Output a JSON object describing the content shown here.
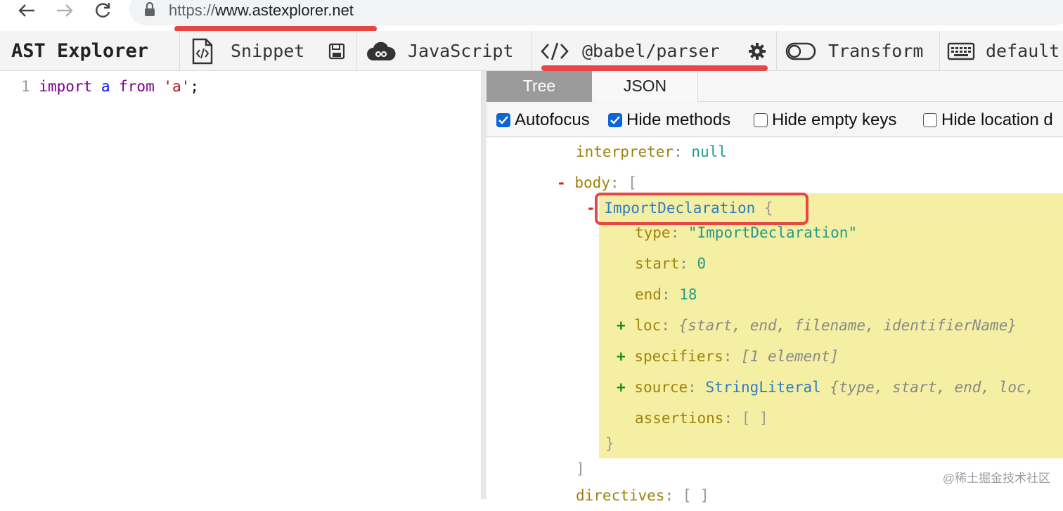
{
  "browser": {
    "url_protocol": "https://",
    "url_host": "www.astexplorer.net"
  },
  "toolbar": {
    "app_title": "AST Explorer",
    "snippet": "Snippet",
    "language": "JavaScript",
    "parser": "@babel/parser",
    "transform": "Transform",
    "keymap": "default"
  },
  "editor": {
    "line_number": "1",
    "tokens": [
      "import",
      "a",
      "from",
      "'a'",
      ";"
    ]
  },
  "panel": {
    "tabs": [
      "Tree",
      "JSON"
    ],
    "options": [
      {
        "label": "Autofocus",
        "checked": true
      },
      {
        "label": "Hide methods",
        "checked": true
      },
      {
        "label": "Hide empty keys",
        "checked": false
      },
      {
        "label": "Hide location d",
        "checked": false
      }
    ]
  },
  "tree": {
    "interpreter_key": "interpreter",
    "interpreter_value": "null",
    "body_key": "body",
    "node_type": "ImportDeclaration",
    "type_key": "type",
    "type_value": "\"ImportDeclaration\"",
    "start_key": "start",
    "start_value": "0",
    "end_key": "end",
    "end_value": "18",
    "loc_key": "loc",
    "loc_summary": "{start, end, filename, identifierName}",
    "specifiers_key": "specifiers",
    "specifiers_summary": "[1 element]",
    "source_key": "source",
    "source_type": "StringLiteral",
    "source_summary": "{type, start, end, loc,",
    "assertions_key": "assertions",
    "assertions_value": "[ ]",
    "directives_key": "directives"
  },
  "watermark": "@稀土掘金技术社区"
}
